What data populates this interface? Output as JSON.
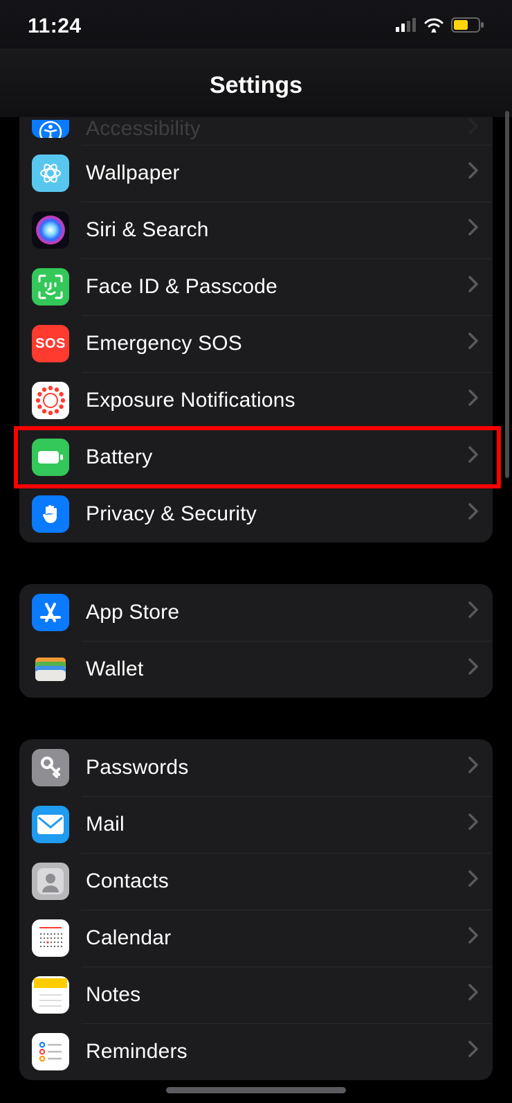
{
  "statusBar": {
    "time": "11:24"
  },
  "pageTitle": "Settings",
  "groups": [
    {
      "id": "system",
      "rows": [
        {
          "id": "accessibility",
          "label": "Accessibility",
          "iconBg": "#0a7aff",
          "iconName": "accessibility-icon"
        },
        {
          "id": "wallpaper",
          "label": "Wallpaper",
          "iconBg": "#58c7f0",
          "iconName": "wallpaper-icon"
        },
        {
          "id": "siri-search",
          "label": "Siri & Search",
          "iconBg": "#1b1b2b",
          "iconName": "siri-icon"
        },
        {
          "id": "faceid-passcode",
          "label": "Face ID & Passcode",
          "iconBg": "#34c759",
          "iconName": "faceid-icon"
        },
        {
          "id": "emergency-sos",
          "label": "Emergency SOS",
          "iconBg": "#ff3b30",
          "iconName": "sos-icon",
          "iconText": "SOS"
        },
        {
          "id": "exposure-notifications",
          "label": "Exposure Notifications",
          "iconBg": "#ffffff",
          "iconName": "exposure-icon"
        },
        {
          "id": "battery",
          "label": "Battery",
          "iconBg": "#34c759",
          "iconName": "battery-icon",
          "highlight": true
        },
        {
          "id": "privacy-security",
          "label": "Privacy & Security",
          "iconBg": "#0a7aff",
          "iconName": "hand-icon"
        }
      ]
    },
    {
      "id": "store",
      "rows": [
        {
          "id": "app-store",
          "label": "App Store",
          "iconBg": "#0a7aff",
          "iconName": "appstore-icon"
        },
        {
          "id": "wallet",
          "label": "Wallet",
          "iconBg": "#1c1c1e",
          "iconName": "wallet-icon"
        }
      ]
    },
    {
      "id": "apps",
      "rows": [
        {
          "id": "passwords",
          "label": "Passwords",
          "iconBg": "#8e8e93",
          "iconName": "key-icon"
        },
        {
          "id": "mail",
          "label": "Mail",
          "iconBg": "#1f9bf0",
          "iconName": "mail-icon"
        },
        {
          "id": "contacts",
          "label": "Contacts",
          "iconBg": "#b8b8ba",
          "iconName": "contacts-icon"
        },
        {
          "id": "calendar",
          "label": "Calendar",
          "iconBg": "#ffffff",
          "iconName": "calendar-icon"
        },
        {
          "id": "notes",
          "label": "Notes",
          "iconBg": "#ffffff",
          "iconName": "notes-icon"
        },
        {
          "id": "reminders",
          "label": "Reminders",
          "iconBg": "#ffffff",
          "iconName": "reminders-icon"
        }
      ]
    }
  ]
}
